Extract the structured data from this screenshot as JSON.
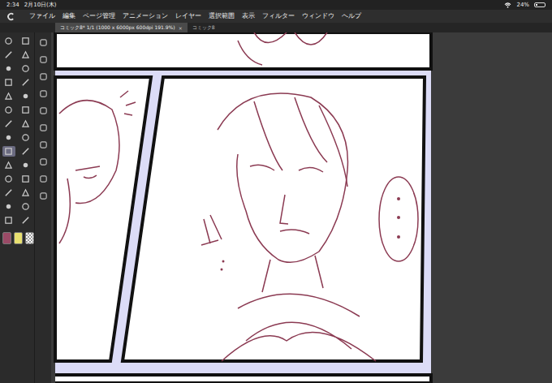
{
  "status_bar": {
    "time": "2:34",
    "date": "2月10日(木)",
    "battery": "24%",
    "battery_level": 0.24
  },
  "menu": [
    "ファイル",
    "編集",
    "ページ管理",
    "アニメーション",
    "レイヤー",
    "選択範囲",
    "表示",
    "フィルター",
    "ウィンドウ",
    "ヘルプ"
  ],
  "tabs": [
    {
      "label": "コミック8* 1/1 (1000 x 6000px 600dpi 191.9%)",
      "selected": true,
      "close": "×"
    },
    {
      "label": "コミック8",
      "selected": false,
      "close": ""
    }
  ],
  "tools": [
    {
      "selected": false
    },
    {
      "selected": false
    },
    {
      "selected": false
    },
    {
      "selected": false
    },
    {
      "selected": false
    },
    {
      "selected": false
    },
    {
      "selected": false
    },
    {
      "selected": false
    },
    {
      "selected": false
    },
    {
      "selected": false
    },
    {
      "selected": false
    },
    {
      "selected": false
    },
    {
      "selected": false
    },
    {
      "selected": false
    },
    {
      "selected": false
    },
    {
      "selected": false
    },
    {
      "selected": true
    },
    {
      "selected": false
    },
    {
      "selected": false
    },
    {
      "selected": false
    },
    {
      "selected": false
    },
    {
      "selected": false
    },
    {
      "selected": false
    },
    {
      "selected": false
    },
    {
      "selected": false
    },
    {
      "selected": false
    },
    {
      "selected": false
    },
    {
      "selected": false
    }
  ],
  "subtools": [
    {
      "selected": false
    },
    {
      "selected": false
    },
    {
      "selected": false
    },
    {
      "selected": false
    },
    {
      "selected": false
    },
    {
      "selected": false
    },
    {
      "selected": false
    },
    {
      "selected": false
    },
    {
      "selected": false
    },
    {
      "selected": false
    }
  ],
  "colors": [
    {
      "color": "#9a4a66"
    },
    {
      "color": "#e8e070"
    },
    {
      "color": "transparent"
    }
  ]
}
